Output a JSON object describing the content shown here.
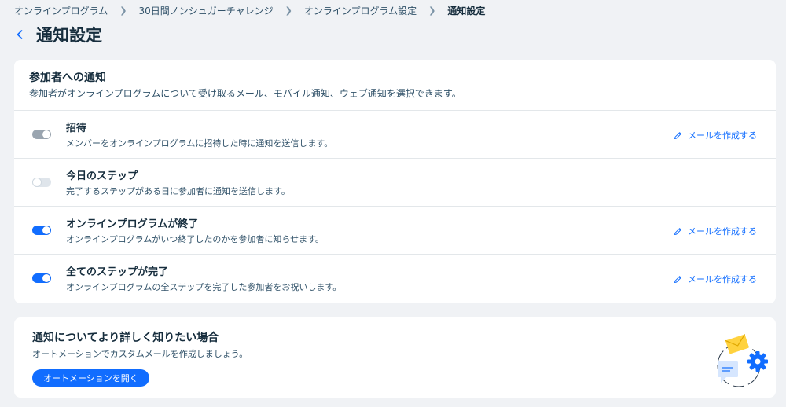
{
  "breadcrumb": {
    "items": [
      "オンラインプログラム",
      "30日間ノンシュガーチャレンジ",
      "オンラインプログラム設定"
    ],
    "current": "通知設定"
  },
  "header": {
    "title": "通知設定"
  },
  "participants_card": {
    "title": "参加者への通知",
    "subtitle": "参加者がオンラインプログラムについて受け取るメール、モバイル通知、ウェブ通知を選択できます。",
    "rows": [
      {
        "title": "招待",
        "desc": "メンバーをオンラインプログラムに招待した時に通知を送信します。",
        "toggle": "on-disabled",
        "link": "メールを作成する"
      },
      {
        "title": "今日のステップ",
        "desc": "完了するステップがある日に参加者に通知を送信します。",
        "toggle": "off"
      },
      {
        "title": "オンラインプログラムが終了",
        "desc": "オンラインプログラムがいつ終了したのかを参加者に知らせます。",
        "toggle": "on",
        "link": "メールを作成する"
      },
      {
        "title": "全てのステップが完了",
        "desc": "オンラインプログラムの全ステップを完了した参加者をお祝いします。",
        "toggle": "on",
        "link": "メールを作成する"
      }
    ]
  },
  "automation_card": {
    "title": "通知についてより詳しく知りたい場合",
    "subtitle": "オートメーションでカスタムメールを作成しましょう。",
    "button": "オートメーションを開く"
  },
  "colors": {
    "accent": "#116dff",
    "text": "#162d3d",
    "background": "#f0f2f5",
    "envelope": "#ffd23f"
  }
}
